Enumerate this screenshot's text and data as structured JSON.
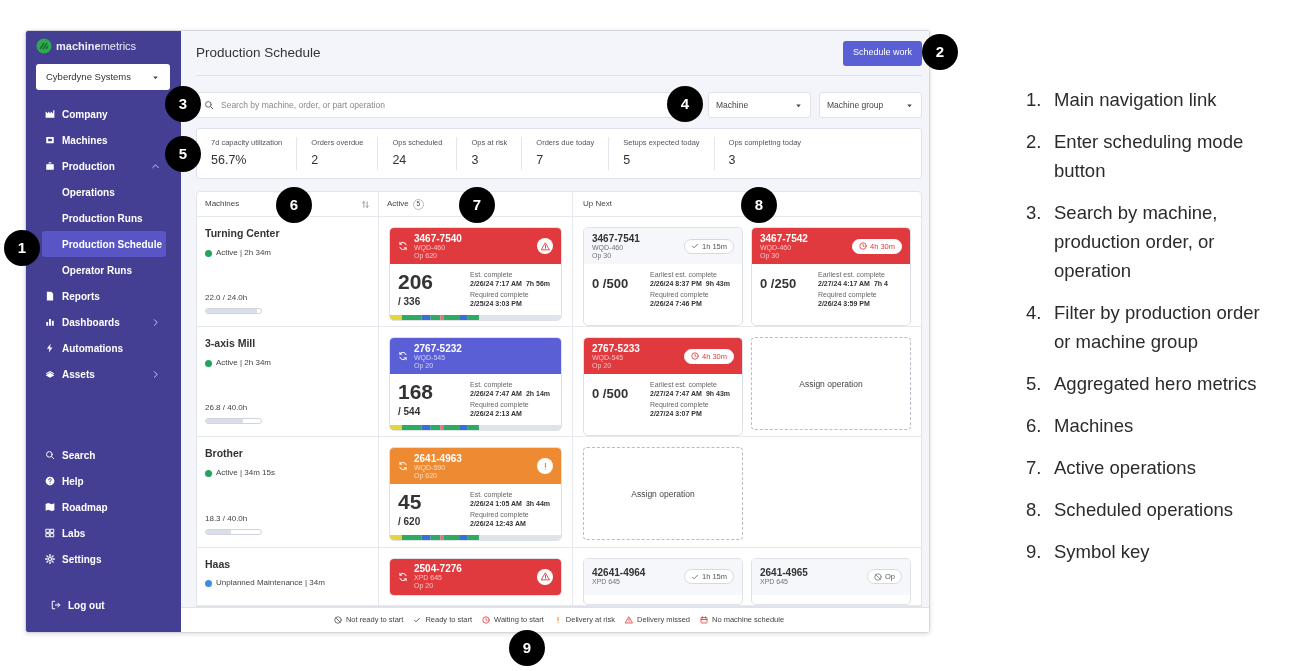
{
  "sidebar": {
    "logo": "**machine**metrics",
    "account": "Cyberdyne Systems",
    "items": [
      {
        "kind": "company",
        "label": "Company",
        "selected": false
      },
      {
        "kind": "machines",
        "label": "Machines",
        "selected": false
      },
      {
        "kind": "production",
        "label": "Production",
        "selected": false,
        "expanded": true,
        "children": [
          {
            "label": "Operations",
            "selected": false
          },
          {
            "label": "Production Runs",
            "selected": false
          },
          {
            "label": "Production Schedule",
            "selected": true
          },
          {
            "label": "Operator Runs",
            "selected": false
          }
        ]
      },
      {
        "kind": "reports",
        "label": "Reports",
        "selected": false
      },
      {
        "kind": "dashboards",
        "label": "Dashboards",
        "selected": false,
        "expanded": false
      },
      {
        "kind": "automations",
        "label": "Automations",
        "selected": false
      },
      {
        "kind": "assets",
        "label": "Assets",
        "selected": false,
        "expanded": false
      }
    ],
    "bottom_items": [
      {
        "kind": "search",
        "label": "Search",
        "selected": false
      },
      {
        "kind": "help",
        "label": "Help",
        "selected": false
      },
      {
        "kind": "roadmap",
        "label": "Roadmap",
        "selected": false
      },
      {
        "kind": "labs",
        "label": "Labs",
        "selected": false
      },
      {
        "kind": "settings",
        "label": "Settings",
        "selected": false
      }
    ],
    "logout": {
      "kind": "logout",
      "label": "Log out"
    }
  },
  "page_title": "Production Schedule",
  "primary_button": "Schedule work",
  "search": {
    "placeholder": "Search by machine, order, or part operation"
  },
  "filters": [
    "Machine",
    "Machine group"
  ],
  "metrics": [
    {
      "label": "7d capacity utilization",
      "value": "56.7%"
    },
    {
      "label": "Orders overdue",
      "value": "2"
    },
    {
      "label": "Ops scheduled",
      "value": "24"
    },
    {
      "label": "Ops at risk",
      "value": "3"
    },
    {
      "label": "Orders due today",
      "value": "7"
    },
    {
      "label": "Setups expected today",
      "value": "5"
    },
    {
      "label": "Ops completing today",
      "value": "3"
    }
  ],
  "schedule": {
    "columns": {
      "machines": "Machines",
      "active": "Active",
      "active_count": "5",
      "up_next": "Up Next"
    },
    "rows": [
      {
        "machine": {
          "name": "Turning Center",
          "status": "Active | 2h 34m",
          "color": "#22a45d",
          "hours": "22.0 / 24.0h",
          "level": 0.92
        },
        "active": {
          "kind": "late",
          "id": "3467-7540",
          "part": "WQD-460",
          "op": "Op 620",
          "badge": {
            "kind": "warning"
          },
          "count": "206",
          "total": "/ 336",
          "est_label": "Est. complete",
          "est": "2/26/24 7:17 AM",
          "est_dur": "7h 56m",
          "req_label": "Required complete",
          "req": "2/25/24 3:03 PM"
        },
        "up_next": [
          {
            "kind": "queued",
            "id": "3467-7541",
            "part": "WQD-460",
            "op": "Op 30",
            "badge": {
              "kind": "check",
              "text": "1h 15m"
            },
            "progress": "0 /500",
            "est_label": "Earliest est. complete",
            "est": "2/26/24 8:37 PM",
            "est_dur": "9h 43m",
            "req_label": "Required complete",
            "req": "2/26/24 7:46 PM"
          },
          {
            "kind": "late",
            "id": "3467-7542",
            "part": "WQD-460",
            "op": "Op 30",
            "badge": {
              "kind": "clock",
              "text": "4h 30m"
            },
            "progress": "0 /250",
            "est_label": "Earliest est. complete",
            "est": "2/27/24 4:17 AM",
            "est_dur": "7h 4",
            "req_label": "Required complete",
            "req": "2/26/24 3:59 PM"
          }
        ]
      },
      {
        "machine": {
          "name": "3-axis Mill",
          "status": "Active | 2h 34m",
          "color": "#22a45d",
          "hours": "26.8 / 40.0h",
          "level": 0.67
        },
        "active": {
          "kind": "running",
          "id": "2767-5232",
          "part": "WQD-545",
          "op": "Op 20",
          "count": "168",
          "total": "/ 544",
          "est_label": "Est. complete",
          "est": "2/26/24 7:47 AM",
          "est_dur": "2h 14m",
          "req_label": "Required complete",
          "req": "2/26/24 2:13 AM"
        },
        "up_next": [
          {
            "kind": "late",
            "id": "2767-5233",
            "part": "WQD-545",
            "op": "Op 20",
            "badge": {
              "kind": "clock",
              "text": "4h 30m"
            },
            "progress": "0 /500",
            "est_label": "Earliest est. complete",
            "est": "2/27/24 7:47 AM",
            "est_dur": "9h 43m",
            "req_label": "Required complete",
            "req": "2/27/24 3:07 PM"
          },
          {
            "kind": "assign",
            "label": "Assign operation"
          }
        ]
      },
      {
        "machine": {
          "name": "Brother",
          "status": "Active | 34m 15s",
          "color": "#22a45d",
          "hours": "18.3 / 40.0h",
          "level": 0.46
        },
        "active": {
          "kind": "risk",
          "id": "2641-4963",
          "part": "WQD-590",
          "op": "Op 620",
          "badge": {
            "kind": "exclaim"
          },
          "count": "45",
          "total": "/ 620",
          "est_label": "Est. complete",
          "est": "2/26/24 1:05 AM",
          "est_dur": "3h 44m",
          "req_label": "Required complete",
          "req": "2/26/24 12:43 AM"
        },
        "up_next": [
          {
            "kind": "assign",
            "label": "Assign operation"
          }
        ]
      },
      {
        "machine": {
          "name": "Haas",
          "status": "Unplanned Maintenance | 34m",
          "color": "#3b8fe0"
        },
        "active": {
          "kind": "late",
          "id": "2504-7276",
          "part": "XPD 645",
          "op": "Op 20",
          "badge": {
            "kind": "warning"
          }
        },
        "up_next": [
          {
            "kind": "queued",
            "id": "42641-4964",
            "part": "XPD 645",
            "badge": {
              "kind": "check",
              "text": "1h 15m"
            }
          },
          {
            "kind": "queued",
            "id": "2641-4965",
            "part": "XPD 645",
            "badge": {
              "kind": "blocked",
              "text": "Op"
            }
          }
        ]
      }
    ]
  },
  "symbol_key": [
    {
      "kind": "blocked",
      "label": "Not ready to start"
    },
    {
      "kind": "check",
      "label": "Ready to start"
    },
    {
      "kind": "clock",
      "label": "Waiting to start"
    },
    {
      "kind": "exclaim",
      "label": "Delivery at risk"
    },
    {
      "kind": "warning",
      "label": "Delivery missed"
    },
    {
      "kind": "calendar",
      "label": "No machine schedule"
    }
  ],
  "callouts": [
    "1",
    "2",
    "3",
    "4",
    "5",
    "6",
    "7",
    "8",
    "9"
  ],
  "annotations": [
    {
      "number": "1.",
      "text": "Main navigation link"
    },
    {
      "number": "2.",
      "text": "Enter scheduling mode button"
    },
    {
      "number": "3.",
      "text": "Search by machine, production order, or operation"
    },
    {
      "number": "4.",
      "text": "Filter by production order or machine group"
    },
    {
      "number": "5.",
      "text": "Aggregated hero metrics"
    },
    {
      "number": "6.",
      "text": "Machines"
    },
    {
      "number": "7.",
      "text": "Active operations"
    },
    {
      "number": "8.",
      "text": "Scheduled operations"
    },
    {
      "number": "9.",
      "text": "Symbol key"
    }
  ]
}
